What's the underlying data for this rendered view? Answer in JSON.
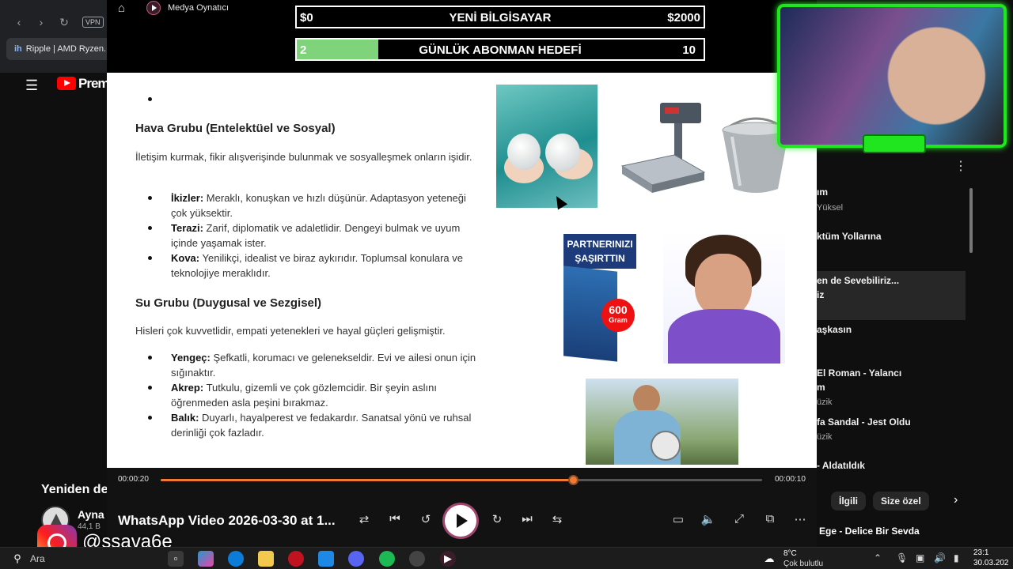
{
  "browser": {
    "tab_title": "Ripple | AMD Ryzen...",
    "vpn": "VPN",
    "youtube_word": "Prem"
  },
  "youtube_left": {
    "section": "Yeniden de",
    "channel_name": "Ayna",
    "channel_subs": "44,1 B"
  },
  "youtube_right": {
    "items": [
      {
        "title": "ım",
        "subtitle": "Yüksel"
      },
      {
        "title": "ktüm Yollarına",
        "subtitle": ""
      },
      {
        "title": "en de Sevebiliriz...",
        "subtitle": "iz"
      },
      {
        "title": "aşkasın",
        "subtitle": ""
      },
      {
        "title": "El Roman - Yalancı",
        "subtitle": "m"
      },
      {
        "title": "",
        "subtitle": "üzik"
      },
      {
        "title": "fa Sandal - Jest Oldu",
        "subtitle": "üzik"
      },
      {
        "title": "- Aldatıldık",
        "subtitle": ""
      }
    ],
    "chips": [
      "Ilgili",
      "İlgili",
      "Size özel"
    ],
    "bottom_item": "Ege - Delice Bir Sevda"
  },
  "player": {
    "app_title": "Medya Oynatıcı",
    "video_title": "WhatsApp Video 2026-03-30 at 1...",
    "current_time": "00:00:20",
    "total_time": "00:00:10",
    "progress": 0.685
  },
  "goals": {
    "computer": {
      "left": "$0",
      "label": "YENİ BİLGİSAYAR",
      "right": "$2000"
    },
    "subs": {
      "left": "2",
      "label": "GÜNLÜK ABONMAN HEDEFİ",
      "right": "10",
      "progress": 0.2
    }
  },
  "doc": {
    "air_heading": "Hava Grubu (Entelektüel ve Sosyal)",
    "air_intro": "İletişim kurmak, fikir alışverişinde bulunmak ve sosyalleşmek onların işidir.",
    "air_items": [
      {
        "name": "İkizler:",
        "text": " Meraklı, konuşkan ve hızlı düşünür. Adaptasyon yeteneği çok yüksektir."
      },
      {
        "name": "Terazi:",
        "text": " Zarif, diplomatik ve adaletlidir. Dengeyi bulmak ve uyum içinde yaşamak ister."
      },
      {
        "name": "Kova:",
        "text": " Yenilikçi, idealist ve biraz aykırıdır. Toplumsal konulara ve teknolojiye meraklıdır."
      }
    ],
    "water_heading": "Su Grubu (Duygusal ve Sezgisel)",
    "water_intro": "Hisleri çok kuvvetlidir, empati yetenekleri ve hayal güçleri gelişmiştir.",
    "water_items": [
      {
        "name": "Yengeç:",
        "text": " Şefkatli, korumacı ve gelenekseldir. Evi ve ailesi onun için sığınaktır."
      },
      {
        "name": "Akrep:",
        "text": " Tutkulu, gizemli ve çok gözlemcidir. Bir şeyin aslını öğrenmeden asla peşini bırakmaz."
      },
      {
        "name": "Balık:",
        "text": " Duyarlı, hayalperest ve fedakardır. Sanatsal yönü ve ruhsal derinliği çok fazladır."
      }
    ],
    "box_text_line1": "PARTNERINIZI",
    "box_text_line2": "ŞAŞIRTTIN",
    "box_badge": "600",
    "box_badge_unit": "Gram"
  },
  "overlay": {
    "instagram_handle": "@ssava6e"
  },
  "taskbar": {
    "search": "Ara",
    "temp": "8°C",
    "weather": "Çok bulutlu",
    "time": "23:1",
    "date": "30.03.202"
  }
}
